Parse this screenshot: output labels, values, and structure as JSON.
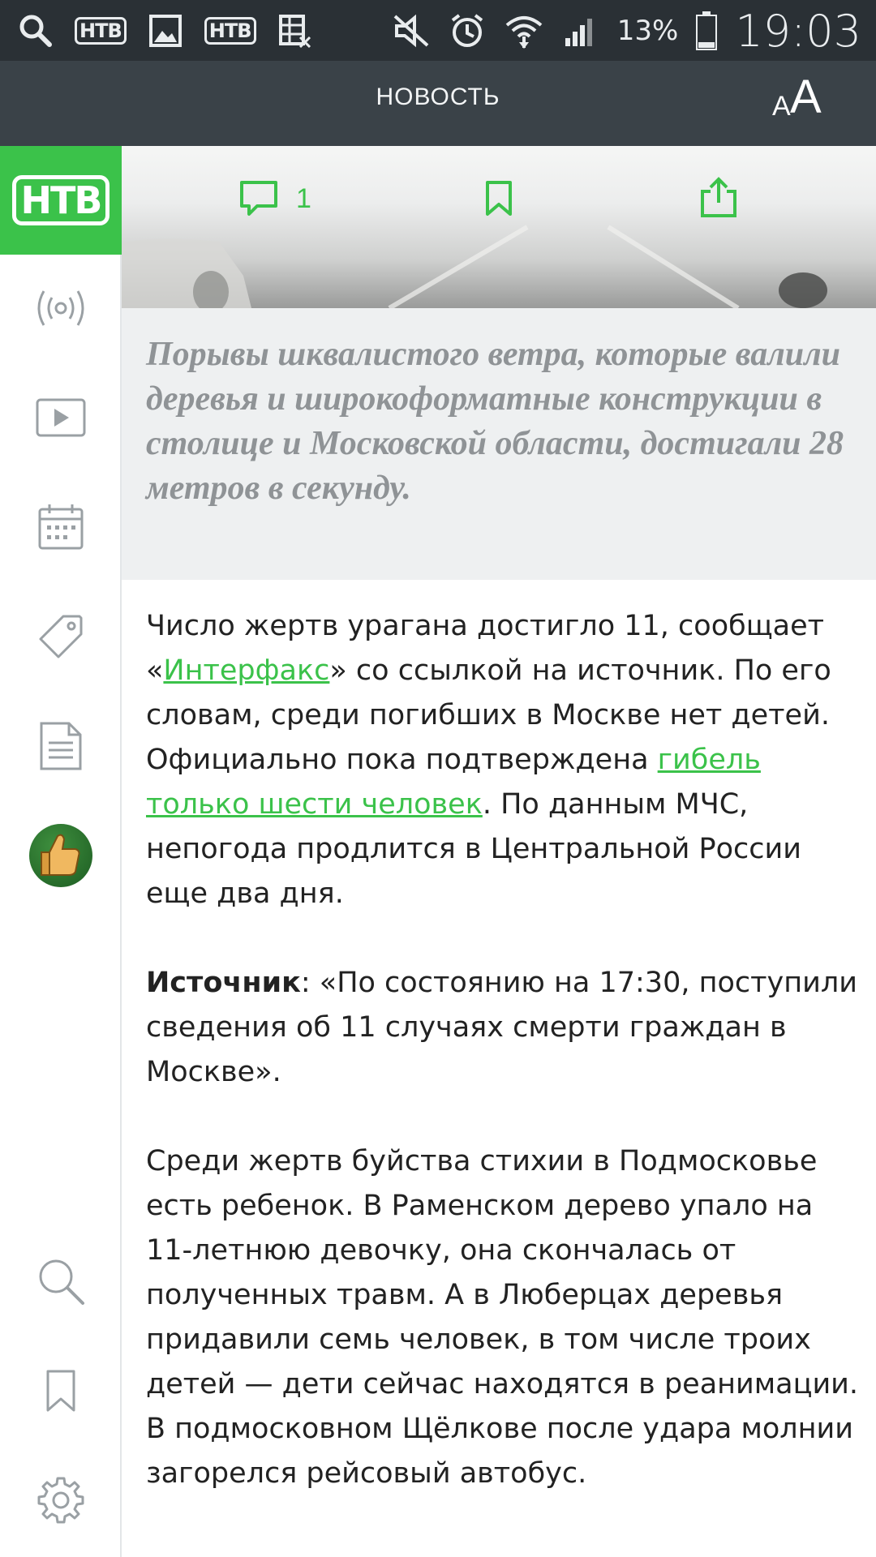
{
  "status_bar": {
    "battery_percent": "13%",
    "time": "19:03",
    "ntv_badge": "НТВ",
    "icons": [
      "search-icon",
      "ntv-icon",
      "image-icon",
      "ntv-icon",
      "spreadsheet-icon",
      "mute-icon",
      "alarm-icon",
      "wifi-icon",
      "signal-icon",
      "battery-icon"
    ]
  },
  "appbar": {
    "title": "НОВОСТЬ",
    "font_size_small": "A",
    "font_size_big": "A"
  },
  "sidebar": {
    "logo": "НТВ",
    "items": [
      "live-icon",
      "video-icon",
      "calendar-icon",
      "tag-icon",
      "document-icon",
      "thumbs-up-icon",
      "search-icon",
      "bookmark-icon",
      "settings-icon"
    ]
  },
  "hero": {
    "comment_count": "1"
  },
  "caption": "Порывы шквалистого ветра, которые валили деревья и широкоформатные конструкции в столице и Московской области, достигали 28 метров в секунду.",
  "article": {
    "p1_part1": "Число жертв урагана достигло 11, сообщает «",
    "p1_link1": "Интерфакс",
    "p1_part2": "» со ссылкой на источник. По его словам, среди погибших в Москве нет детей. Официально пока подтверждена ",
    "p1_link2": "гибель только шести человек",
    "p1_part3": ". По данным МЧС, непогода продлится в Центральной России еще два дня.",
    "p2_bold": "Источник",
    "p2_text": ": «По состоянию на 17:30, поступили сведения об 11 случаях смерти граждан в Москве».",
    "p3_text": "Среди жертв буйства стихии в Подмосковье есть ребенок. В Раменском дерево упало на 11-летнюю девочку, она скончалась от полученных травм. А в Люберцах деревья придавили семь человек, в том числе троих детей — дети сейчас находятся в реанимации. В подмосковном Щёлкове после удара молнии загорелся рейсовый автобус."
  },
  "colors": {
    "accent": "#3bc24a",
    "status_bar": "#2a3035",
    "app_bar": "#3a4248",
    "caption_bg": "#eef0f1",
    "caption_text": "#8f9396"
  }
}
